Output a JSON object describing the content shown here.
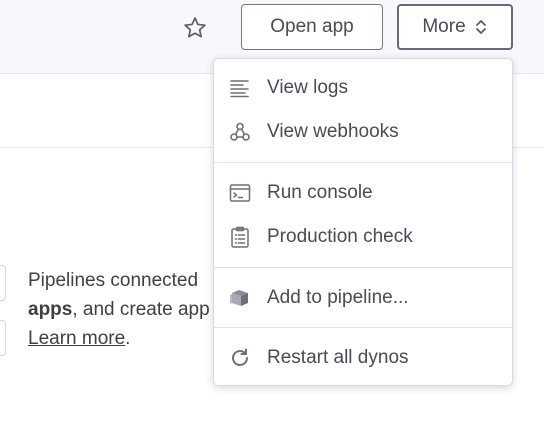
{
  "header": {
    "open_app_label": "Open app",
    "more_label": "More"
  },
  "pipeline_section": {
    "line1": "Pipelines connected",
    "line2_bold": "apps",
    "line2_rest": ", and create app",
    "learn_more": "Learn more",
    "period": "."
  },
  "menu": {
    "items": [
      {
        "label": "View logs",
        "icon": "logs-icon"
      },
      {
        "label": "View webhooks",
        "icon": "webhooks-icon"
      },
      {
        "label": "Run console",
        "icon": "console-icon"
      },
      {
        "label": "Production check",
        "icon": "clipboard-icon"
      },
      {
        "label": "Add to pipeline...",
        "icon": "pipeline-icon"
      },
      {
        "label": "Restart all dynos",
        "icon": "restart-icon"
      }
    ]
  },
  "colors": {
    "text": "#3f3f44",
    "icon": "#6f6e7d",
    "border": "#79748a",
    "topbar_bg": "#f7f8fb"
  }
}
